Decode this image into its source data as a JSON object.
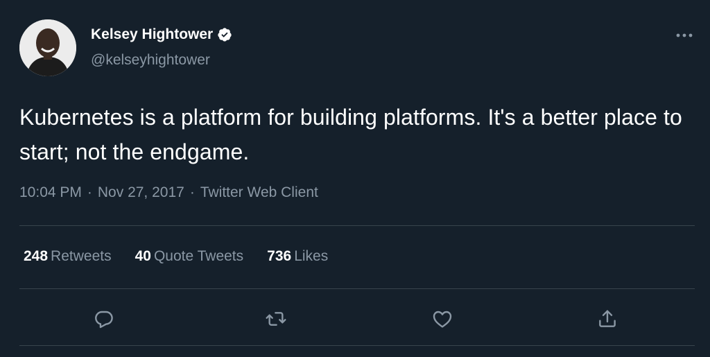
{
  "author": {
    "display_name": "Kelsey Hightower",
    "handle": "@kelseyhightower",
    "verified": true
  },
  "tweet": {
    "text": "Kubernetes is a platform for building platforms. It's a better place to start; not the endgame.",
    "time": "10:04 PM",
    "date": "Nov 27, 2017",
    "source": "Twitter Web Client",
    "separator": "·"
  },
  "stats": {
    "retweets_count": "248",
    "retweets_label": "Retweets",
    "quotes_count": "40",
    "quotes_label": "Quote Tweets",
    "likes_count": "736",
    "likes_label": "Likes"
  },
  "icons": {
    "more": "more-horizontal-icon",
    "reply": "reply-bubble-icon",
    "retweet": "retweet-icon",
    "like": "heart-icon",
    "share": "share-icon",
    "verified": "verified-badge-icon"
  },
  "colors": {
    "background": "#15202b",
    "text_primary": "#ffffff",
    "text_secondary": "#8b98a5",
    "divider": "#38444d",
    "verified_badge": "#ffffff"
  }
}
